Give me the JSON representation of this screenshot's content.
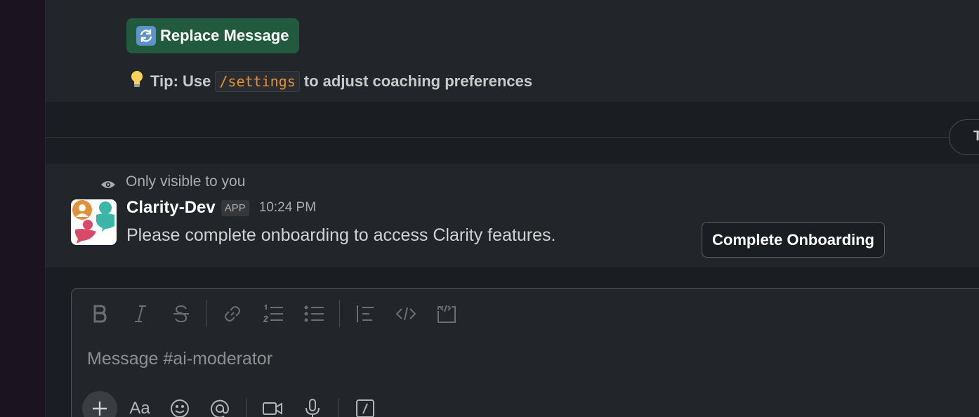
{
  "previous_message": {
    "replace_button": {
      "label": "Replace Message",
      "icon": "arrows-refresh-icon"
    },
    "tip": {
      "prefix": "Tip: Use",
      "command": "/settings",
      "suffix": "to adjust coaching preferences",
      "icon": "light-bulb-icon"
    }
  },
  "divider_pill": {
    "label": "T"
  },
  "ephemeral_message": {
    "visibility_text": "Only visible to you",
    "sender": "Clarity-Dev",
    "badge": "APP",
    "time": "10:24 PM",
    "text": "Please complete onboarding to access Clarity features.",
    "action_button": "Complete Onboarding"
  },
  "composer": {
    "placeholder": "Message #ai-moderator",
    "format_tools": [
      "bold-icon",
      "italic-icon",
      "strikethrough-icon",
      "link-icon",
      "ordered-list-icon",
      "bulleted-list-icon",
      "blockquote-icon",
      "code-icon",
      "code-block-icon"
    ],
    "bottom_tools": [
      "plus-icon",
      "text-format-icon",
      "emoji-icon",
      "mention-icon",
      "video-icon",
      "microphone-icon",
      "slash-command-icon"
    ],
    "text_format_label": "Aa"
  },
  "colors": {
    "replace_button_bg": "#215a3f",
    "command_text": "#e8912d",
    "background": "#1a1d21"
  }
}
